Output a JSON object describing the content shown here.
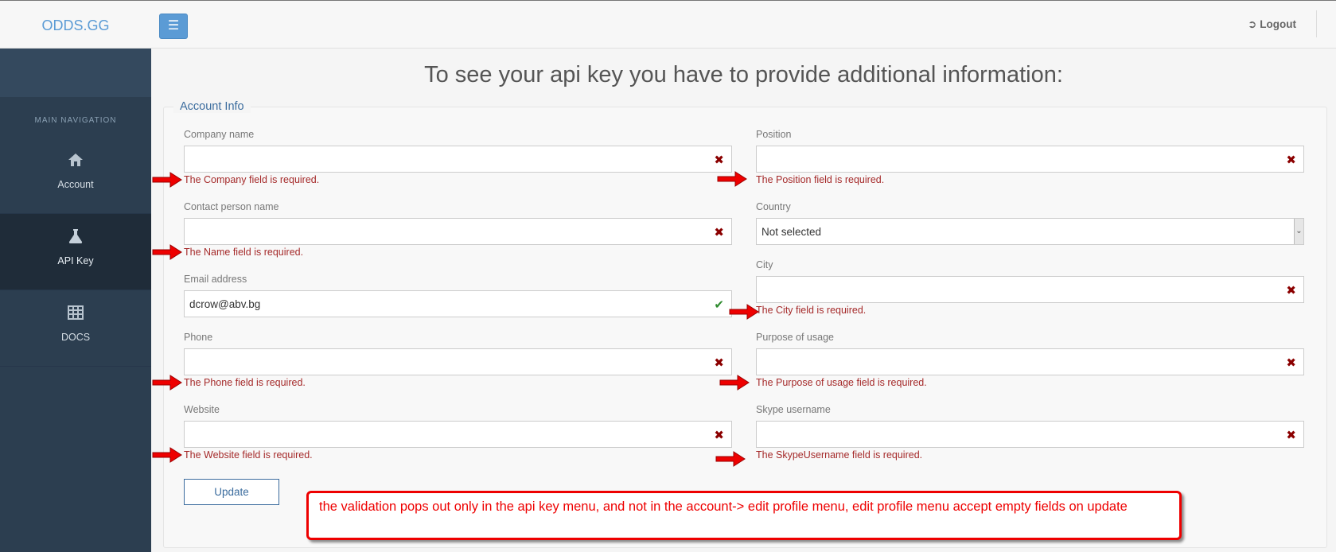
{
  "app": {
    "logo": "ODDS.GG"
  },
  "topbar": {
    "logout_label": "Logout",
    "logout_icon": "sign-out-icon",
    "menu_icon": "hamburger-icon"
  },
  "sidebar": {
    "title": "MAIN NAVIGATION",
    "items": [
      {
        "label": "Account",
        "icon": "home-icon",
        "active": false
      },
      {
        "label": "API Key",
        "icon": "flask-icon",
        "active": true
      },
      {
        "label": "DOCS",
        "icon": "table-icon",
        "active": false
      }
    ]
  },
  "page": {
    "heading": "To see your api key you have to provide additional information:",
    "legend": "Account Info",
    "update_label": "Update"
  },
  "fields": {
    "company": {
      "label": "Company name",
      "value": "",
      "error": "The Company field is required."
    },
    "contact": {
      "label": "Contact person name",
      "value": "",
      "error": "The Name field is required."
    },
    "email": {
      "label": "Email address",
      "value": "dcrow@abv.bg",
      "error": ""
    },
    "phone": {
      "label": "Phone",
      "value": "",
      "error": "The Phone field is required."
    },
    "website": {
      "label": "Website",
      "value": "",
      "error": "The Website field is required."
    },
    "position": {
      "label": "Position",
      "value": "",
      "error": "The Position field is required."
    },
    "country": {
      "label": "Country",
      "value": "Not selected",
      "error": ""
    },
    "city": {
      "label": "City",
      "value": "",
      "error": "The City field is required."
    },
    "purpose": {
      "label": "Purpose of usage",
      "value": "",
      "error": "The Purpose of usage field is required."
    },
    "skype": {
      "label": "Skype username",
      "value": "",
      "error": "The SkypeUsername field is required."
    }
  },
  "annotation": {
    "text": "the validation pops out only in the api key menu, and not in the account-> edit profile menu, edit profile menu accept empty fields on update"
  },
  "colors": {
    "accent": "#5b9bd5",
    "sidebar": "#2c3e50",
    "error": "#a52a2a",
    "annotation": "#e00000"
  }
}
